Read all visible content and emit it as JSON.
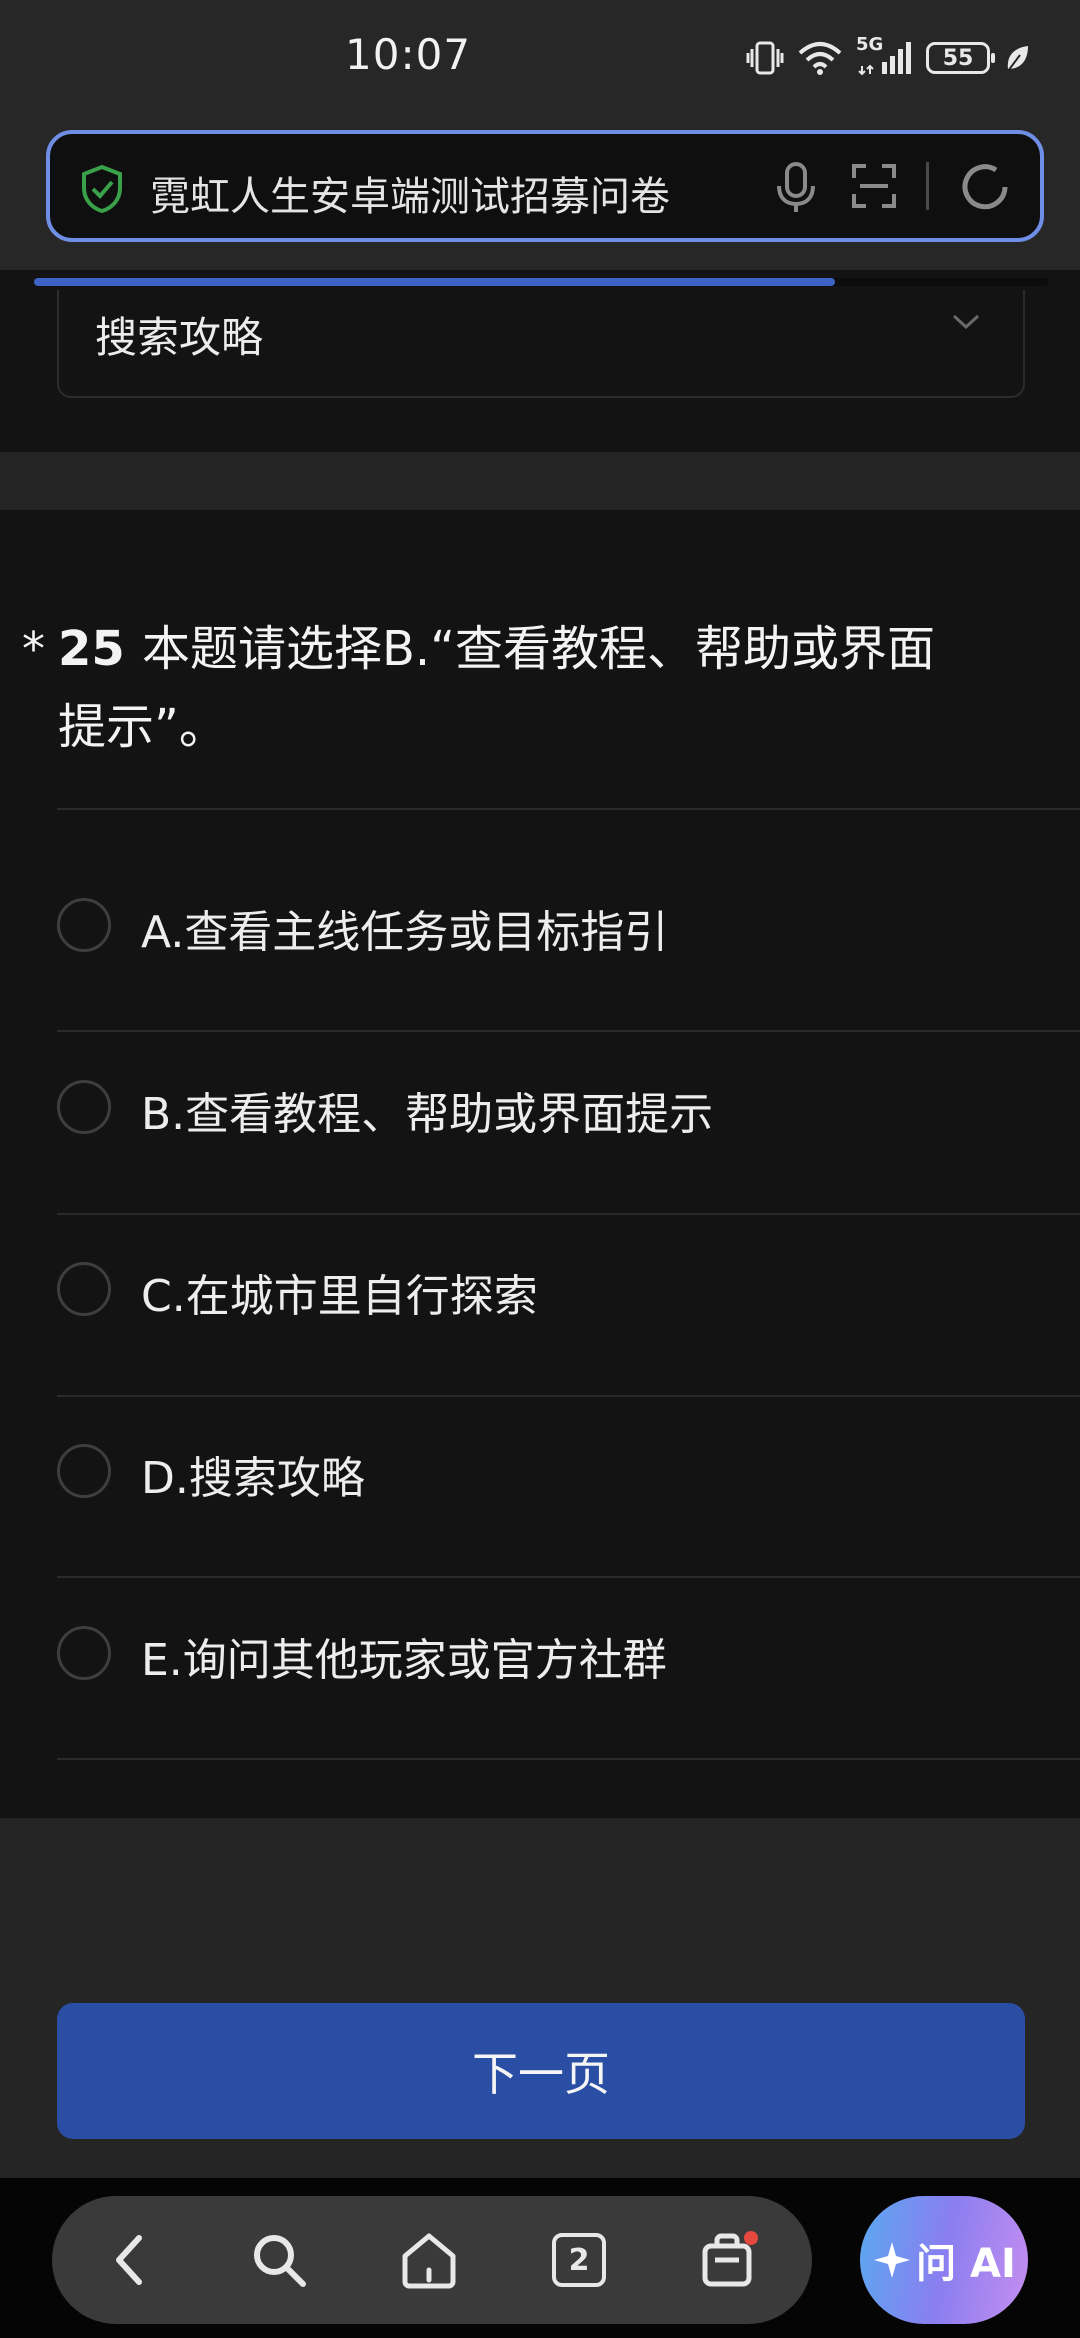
{
  "status_bar": {
    "time": "10:07",
    "network": "5G",
    "battery": "55"
  },
  "address_bar": {
    "url_title": "霓虹人生安卓端测试招募问卷",
    "progress_percent": 79
  },
  "previous_question": {
    "selected_value": "搜索攻略"
  },
  "question": {
    "required_mark": "*",
    "number": "25",
    "text_line1": "本题请选择B.“查看教程、帮助或界面",
    "text_line2": "提示”。",
    "options": [
      {
        "label": "A.查看主线任务或目标指引"
      },
      {
        "label": "B.查看教程、帮助或界面提示"
      },
      {
        "label": "C.在城市里自行探索"
      },
      {
        "label": "D.搜索攻略"
      },
      {
        "label": "E.询问其他玩家或官方社群"
      }
    ]
  },
  "next_button": {
    "label": "下一页"
  },
  "bottom_nav": {
    "tab_count": "2",
    "ai_label": "问 AI"
  },
  "colors": {
    "accent": "#2a4ea3",
    "progress": "#3d63c7",
    "address_border": "#6f8fe6",
    "shield": "#3aa04a"
  }
}
